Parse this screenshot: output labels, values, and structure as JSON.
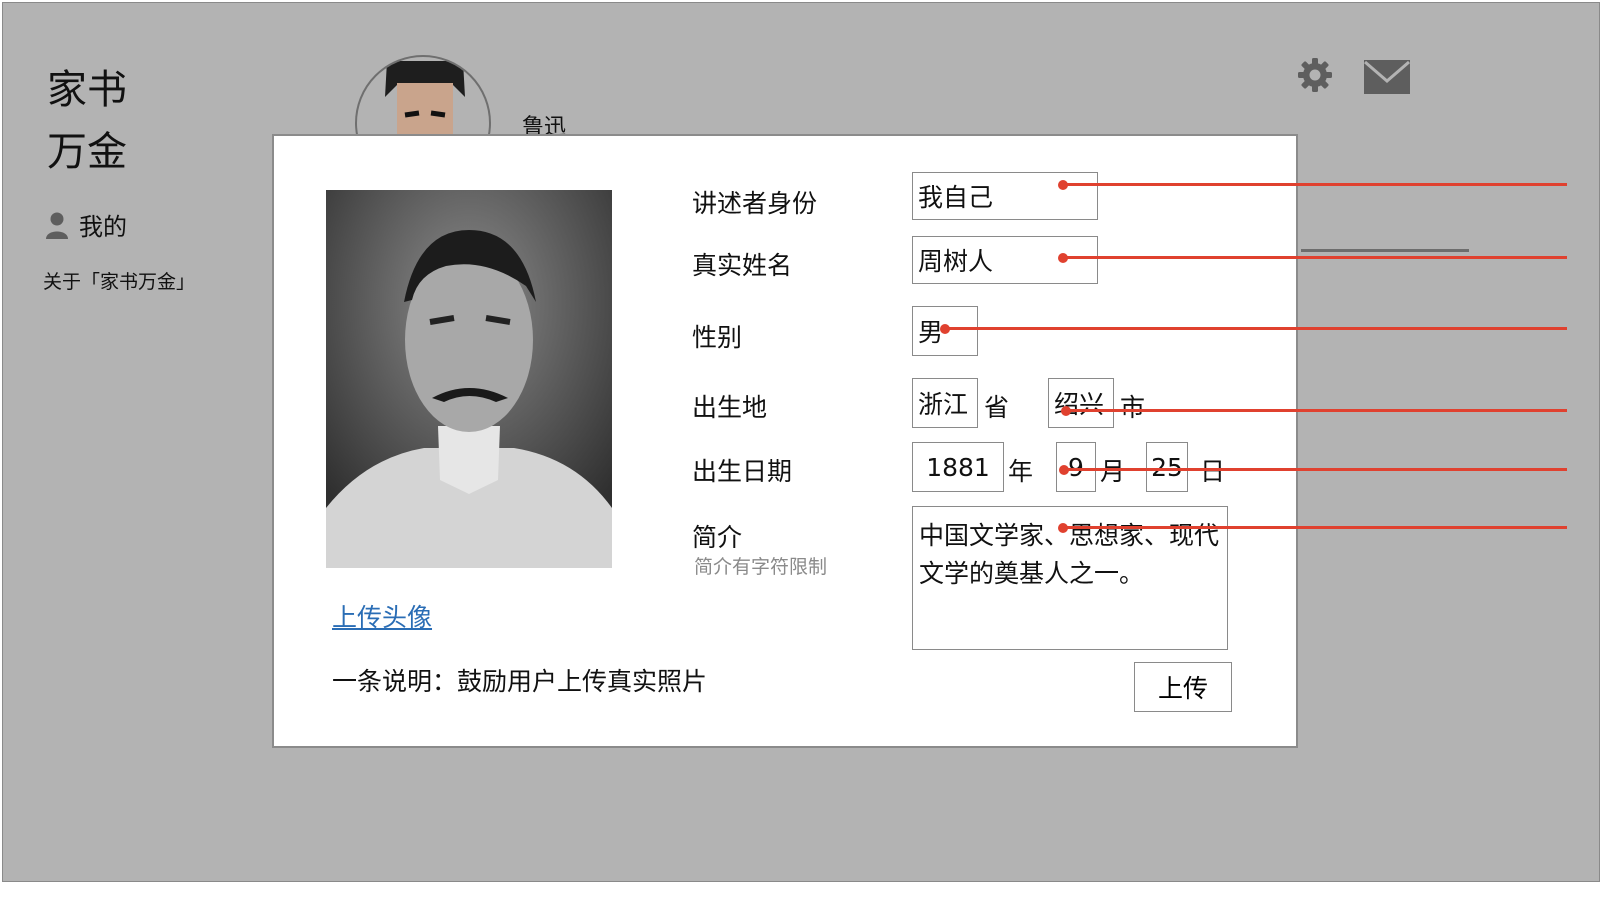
{
  "app": {
    "logo_line1": "家书",
    "logo_line2": "万金",
    "nav_my": "我的",
    "nav_about": "关于「家书万金」",
    "user_name": "鲁迅"
  },
  "profile_form": {
    "narrator_label": "讲述者身份",
    "narrator_value": "我自己",
    "realname_label": "真实姓名",
    "realname_value": "周树人",
    "gender_label": "性别",
    "gender_value": "男",
    "birthplace_label": "出生地",
    "province_value": "浙江",
    "province_unit": "省",
    "city_value": "绍兴",
    "city_unit": "市",
    "birthdate_label": "出生日期",
    "year_value": "1881",
    "year_unit": "年",
    "month_value": "9",
    "month_unit": "月",
    "day_value": "25",
    "day_unit": "日",
    "bio_label": "简介",
    "bio_hint": "简介有字符限制",
    "bio_value": "中国文学家、思想家、现代文学的奠基人之一。",
    "upload_avatar_link": "上传头像",
    "note": "一条说明：鼓励用户上传真实照片",
    "submit_button": "上传"
  },
  "colors": {
    "background": "#b3b3b3",
    "modal": "#ffffff",
    "link": "#2a6db5",
    "annotation": "#e0412f"
  },
  "icons": [
    "user-icon",
    "gear-icon",
    "mail-icon"
  ]
}
